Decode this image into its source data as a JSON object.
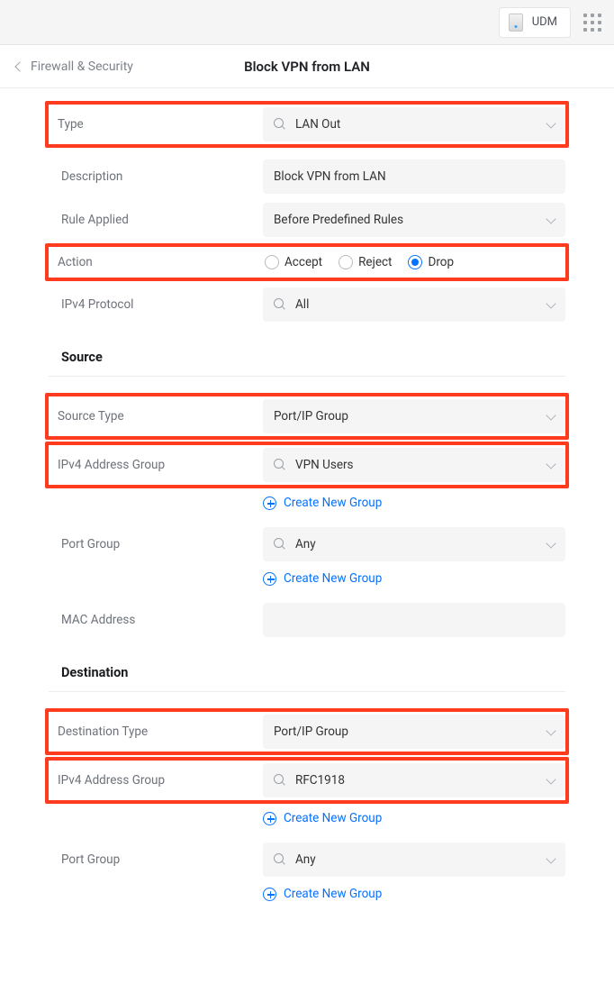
{
  "topbar": {
    "device_label": "UDM"
  },
  "header": {
    "back_label": "Firewall & Security",
    "title": "Block VPN from LAN"
  },
  "fields": {
    "type": {
      "label": "Type",
      "value": "LAN Out"
    },
    "description": {
      "label": "Description",
      "value": "Block VPN from LAN"
    },
    "rule_applied": {
      "label": "Rule Applied",
      "value": "Before Predefined Rules"
    },
    "action": {
      "label": "Action",
      "options": {
        "accept": "Accept",
        "reject": "Reject",
        "drop": "Drop"
      },
      "selected": "drop"
    },
    "ipv4_protocol": {
      "label": "IPv4 Protocol",
      "value": "All"
    }
  },
  "source": {
    "heading": "Source",
    "type": {
      "label": "Source Type",
      "value": "Port/IP Group"
    },
    "ipv4_group": {
      "label": "IPv4 Address Group",
      "value": "VPN Users"
    },
    "port_group": {
      "label": "Port Group",
      "value": "Any"
    },
    "mac": {
      "label": "MAC Address",
      "value": ""
    },
    "create_link": "Create New Group"
  },
  "destination": {
    "heading": "Destination",
    "type": {
      "label": "Destination Type",
      "value": "Port/IP Group"
    },
    "ipv4_group": {
      "label": "IPv4 Address Group",
      "value": "RFC1918"
    },
    "port_group": {
      "label": "Port Group",
      "value": "Any"
    },
    "create_link": "Create New Group"
  }
}
